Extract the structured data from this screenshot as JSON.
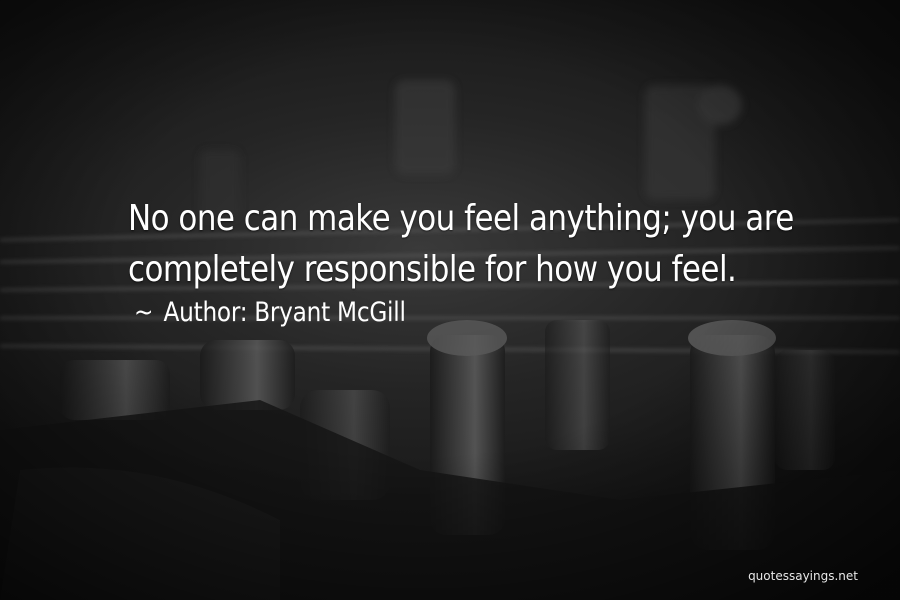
{
  "quote": {
    "line1": "No one can make you feel anything; you are",
    "line2": "completely responsible for how you feel.",
    "author_prefix": "~",
    "author_label": "Author:",
    "author_name": "Bryant McGill"
  },
  "watermark": "quotessayings.net",
  "colors": {
    "text": "#ffffff",
    "background": "#1c1c1c"
  }
}
